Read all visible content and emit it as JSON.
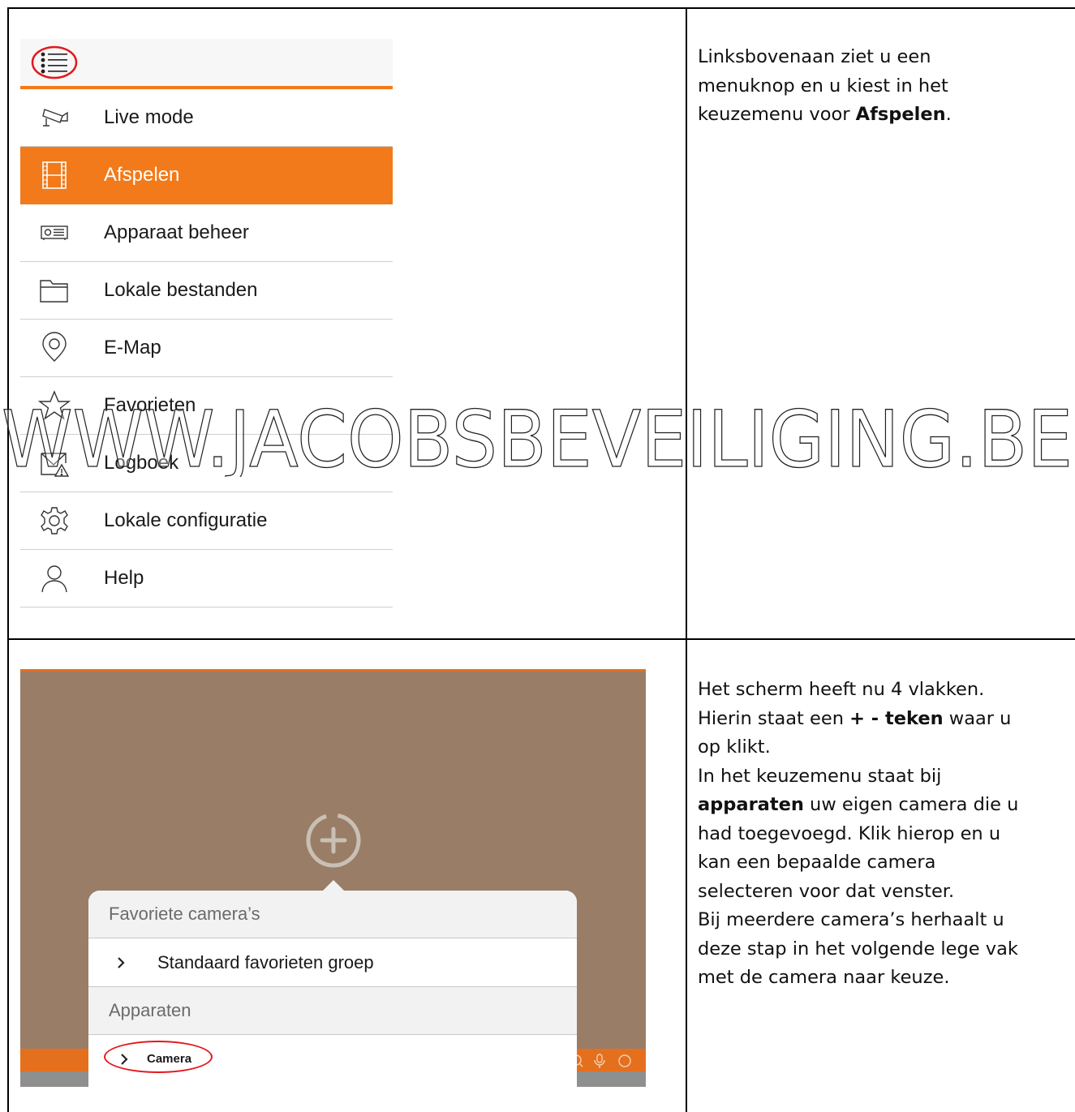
{
  "menu": {
    "items": [
      {
        "label": "Live mode",
        "icon": "cctv-camera-icon",
        "active": false
      },
      {
        "label": "Afspelen",
        "icon": "film-strip-icon",
        "active": true
      },
      {
        "label": "Apparaat beheer",
        "icon": "dvr-device-icon",
        "active": false
      },
      {
        "label": "Lokale bestanden",
        "icon": "folder-icon",
        "active": false
      },
      {
        "label": "E-Map",
        "icon": "location-pin-icon",
        "active": false
      },
      {
        "label": "Favorieten",
        "icon": "star-icon",
        "active": false
      },
      {
        "label": "Logboek",
        "icon": "warning-envelope-icon",
        "active": false
      },
      {
        "label": "Lokale configuratie",
        "icon": "gear-icon",
        "active": false
      },
      {
        "label": "Help",
        "icon": "user-icon",
        "active": false
      }
    ],
    "accent_color": "#f27a1a"
  },
  "step1": {
    "line1": "Linksbovenaan ziet u een",
    "line2": "menuknop en u kiest in het",
    "line3_pre": "keuzemenu voor ",
    "line3_bold": "Afspelen",
    "line3_post": "."
  },
  "step2": {
    "line1": "Het scherm heeft nu 4 vlakken.",
    "line2_pre": "Hierin staat een ",
    "line2_bold": "+ - teken",
    "line2_post": " waar u",
    "line3": "op klikt.",
    "line4": "In het keuzemenu staat bij",
    "line5_bold": "apparaten",
    "line5_post": " uw eigen camera die u",
    "line6": "had toegevoegd. Klik hierop en u",
    "line7": "kan een bepaalde camera",
    "line8": "selecteren voor dat venster.",
    "line9": "Bij meerdere camera’s herhaalt u",
    "line10": "deze stap in het volgende lege vak",
    "line11": "met de camera naar keuze."
  },
  "popover": {
    "section1": "Favoriete camera’s",
    "row1": "Standaard favorieten groep",
    "section2": "Apparaten",
    "row2": "Camera"
  },
  "watermark": {
    "text": "WWW.JACOBSBEVEILIGING.BE"
  }
}
